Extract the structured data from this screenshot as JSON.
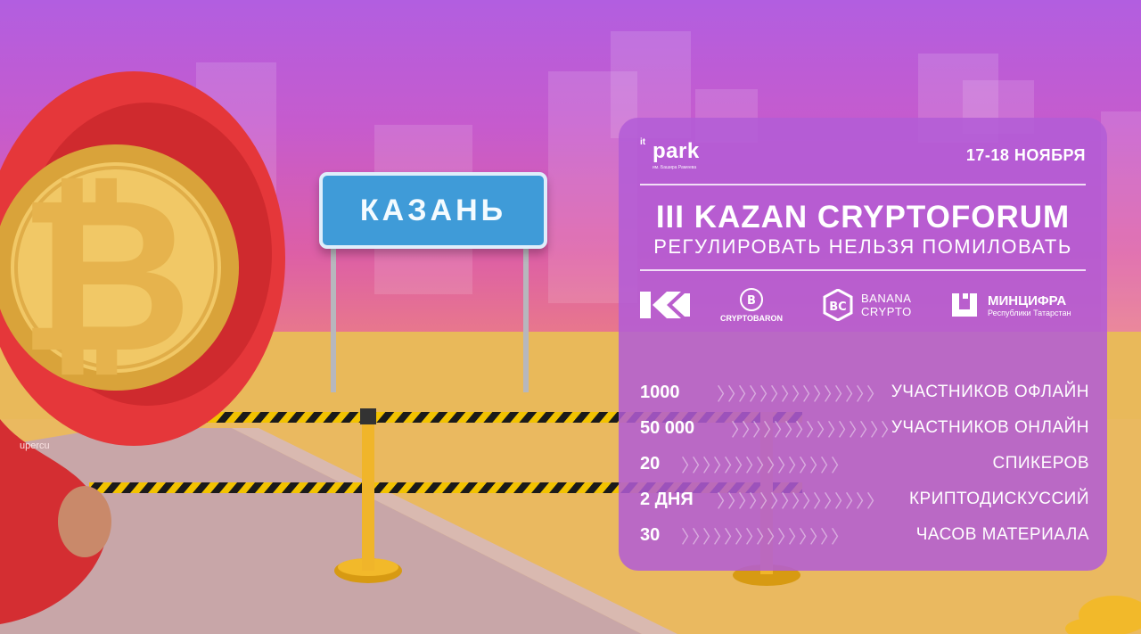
{
  "sign": {
    "text": "КАЗАНЬ"
  },
  "glove": {
    "brand": "upercu"
  },
  "panel": {
    "organizer": {
      "logo_small": "it",
      "logo_main": "park",
      "logo_caption": "им. Башира Рамеева"
    },
    "date": "17-18 НОЯБРЯ",
    "title": "III KAZAN CRYPTOFORUM",
    "subtitle": "РЕГУЛИРОВАТЬ НЕЛЬЗЯ ПОМИЛОВАТЬ",
    "partners": [
      {
        "icon": "k-logo-icon",
        "label": ""
      },
      {
        "icon": "cryptobaron-logo-icon",
        "label": "CRYPTOBARON"
      },
      {
        "icon": "banana-crypto-logo-icon",
        "label_line1": "BANANA",
        "label_line2": "CRYPTO"
      },
      {
        "icon": "mincifra-logo-icon",
        "label_line1": "МИНЦИФРА",
        "label_line2": "Республики Татарстан"
      }
    ],
    "stats": [
      {
        "value": "1000",
        "label": "УЧАСТНИКОВ ОФЛАЙН"
      },
      {
        "value": "50 000",
        "label": "УЧАСТНИКОВ ОНЛАЙН"
      },
      {
        "value": "20",
        "label": "СПИКЕРОВ"
      },
      {
        "value": "2 ДНЯ",
        "label": "КРИПТОДИСКУССИЙ"
      },
      {
        "value": "30",
        "label": "ЧАСОВ МАТЕРИАЛА"
      }
    ],
    "chevrons": "〉〉〉〉〉〉〉〉〉〉〉〉〉〉〉"
  },
  "colors": {
    "accent": "#b25cd6",
    "sign": "#3f9bd8",
    "tape_yellow": "#f2c200",
    "tape_black": "#1a1a1a"
  }
}
